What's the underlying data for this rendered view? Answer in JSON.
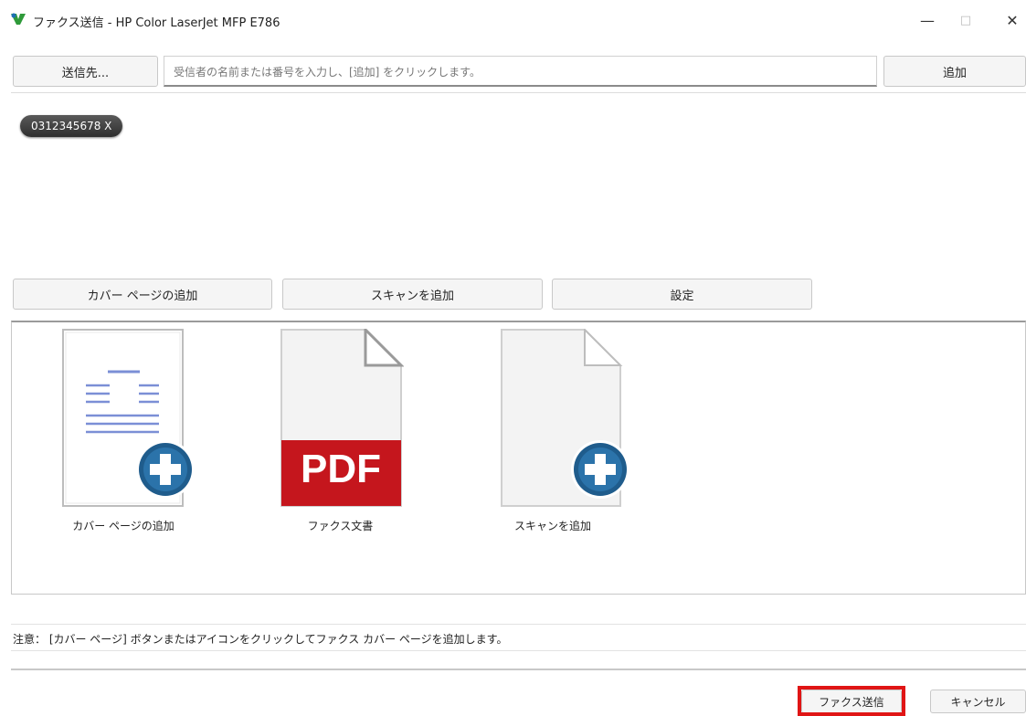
{
  "window": {
    "title": "ファクス送信 - HP Color LaserJet MFP E786",
    "minimize": "—",
    "maximize": "□",
    "close": "✕"
  },
  "recipients": {
    "send_to_label": "送信先...",
    "input_placeholder": "受信者の名前または番号を入力し、[追加] をクリックします。",
    "add_label": "追加",
    "chips": [
      "0312345678 X"
    ]
  },
  "actions": {
    "add_cover_page": "カバー ページの追加",
    "add_scan": "スキャンを追加",
    "settings": "設定"
  },
  "documents": [
    {
      "label": "カバー ページの追加",
      "icon": "cover-page-add-icon"
    },
    {
      "label": "ファクス文書",
      "icon": "pdf-document-icon",
      "badge": "PDF"
    },
    {
      "label": "スキャンを追加",
      "icon": "scan-add-icon"
    }
  ],
  "note": "注意： [カバー ページ] ボタンまたはアイコンをクリックしてファクス カバー ページを追加します。",
  "footer": {
    "send_fax": "ファクス送信",
    "cancel": "キャンセル"
  },
  "colors": {
    "highlight": "#e01515",
    "plus_badge": "#1f5c8c",
    "pdf_red": "#c5161d"
  }
}
